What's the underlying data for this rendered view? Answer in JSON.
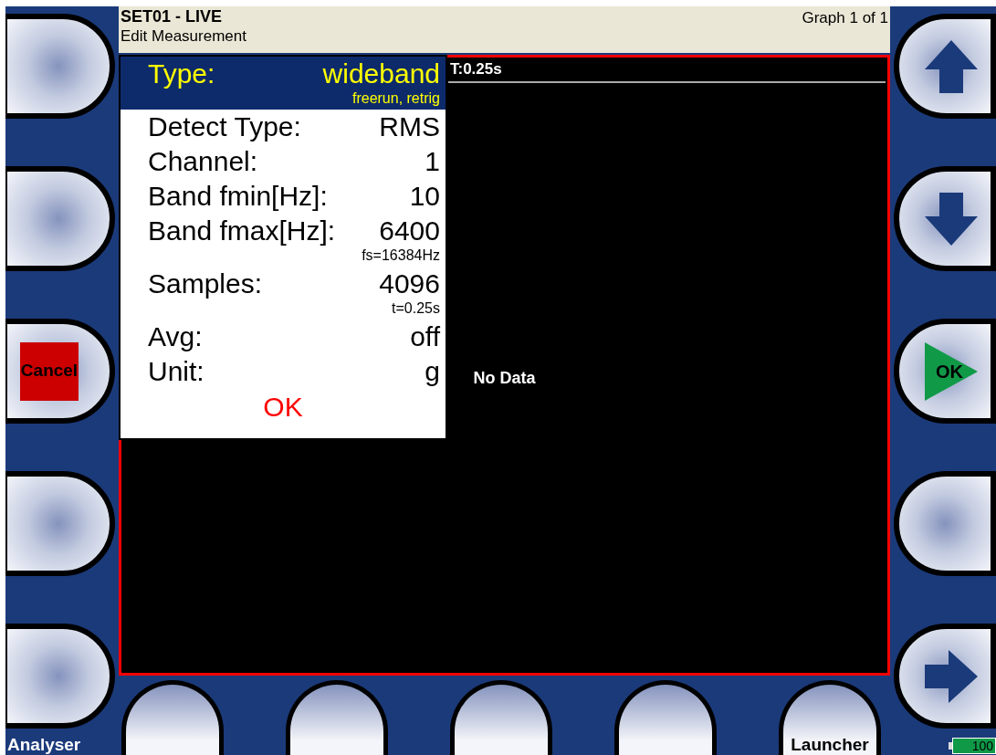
{
  "header": {
    "title": "SET01 - LIVE",
    "subtitle": "Edit Measurement",
    "graph_counter": "Graph 1 of 1"
  },
  "graph": {
    "time_label": "T:0.25s",
    "message": "No Data"
  },
  "dialog": {
    "rows": [
      {
        "label": "Type:",
        "value": "wideband",
        "note": "freerun, retrig",
        "selected": true
      },
      {
        "label": "Detect Type:",
        "value": "RMS",
        "selected": false
      },
      {
        "label": "Channel:",
        "value": "1",
        "selected": false
      },
      {
        "label": "Band fmin[Hz]:",
        "value": "10",
        "selected": false
      },
      {
        "label": "Band fmax[Hz]:",
        "value": "6400",
        "note": "fs=16384Hz",
        "selected": false
      },
      {
        "label": "Samples:",
        "value": "4096",
        "note": "t=0.25s",
        "selected": false
      },
      {
        "label": "Avg:",
        "value": "off",
        "selected": false
      },
      {
        "label": "Unit:",
        "value": "g",
        "selected": false
      }
    ],
    "ok": "OK"
  },
  "left_buttons": [
    {
      "kind": "blank"
    },
    {
      "kind": "blank"
    },
    {
      "kind": "cancel",
      "label": "Cancel"
    },
    {
      "kind": "blank"
    },
    {
      "kind": "blank"
    }
  ],
  "left_caption": "Analyser",
  "right_buttons": [
    {
      "kind": "up"
    },
    {
      "kind": "down"
    },
    {
      "kind": "ok",
      "label": "OK"
    },
    {
      "kind": "blank"
    },
    {
      "kind": "right"
    }
  ],
  "bottom_buttons": [
    {
      "kind": "blank"
    },
    {
      "kind": "blank"
    },
    {
      "kind": "blank"
    },
    {
      "kind": "blank"
    },
    {
      "kind": "labeled",
      "label": "Launcher"
    }
  ],
  "battery": "100"
}
